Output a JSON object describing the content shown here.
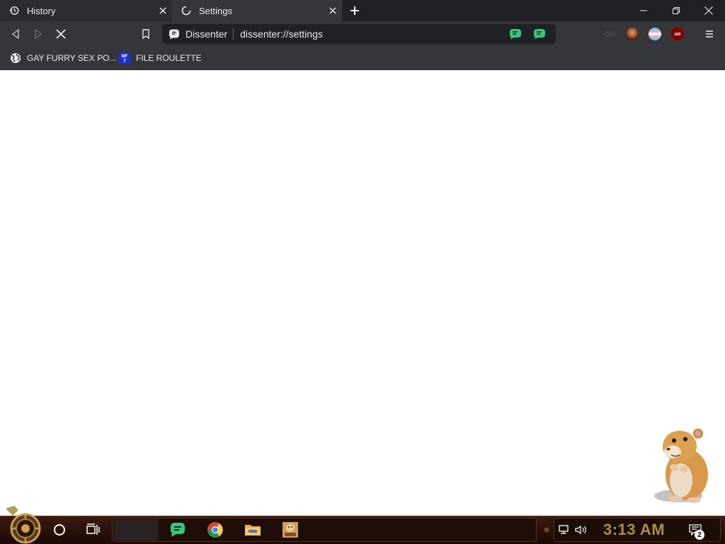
{
  "browser": {
    "tabs": [
      {
        "label": "History",
        "icon": "history-icon",
        "active": false
      },
      {
        "label": "Settings",
        "icon": "loading-spinner-icon",
        "active": true
      }
    ],
    "omnibox": {
      "site_label": "Dissenter",
      "url": "dissenter://settings"
    },
    "bookmarks": [
      {
        "label": "GAY FURRY SEX PO...",
        "icon": "globe-icon"
      },
      {
        "label": "FILE ROULETTE",
        "icon": "mft-icon"
      }
    ]
  },
  "taskbar": {
    "clock": "3:13 AM",
    "notification_count": "2",
    "pinned_apps": [
      "dissenter-browser",
      "chrome",
      "file-explorer",
      "game"
    ]
  },
  "colors": {
    "titlebar": "#202124",
    "toolbar": "#35363a",
    "accent_green": "#3ac47d",
    "clock": "#a89040"
  }
}
